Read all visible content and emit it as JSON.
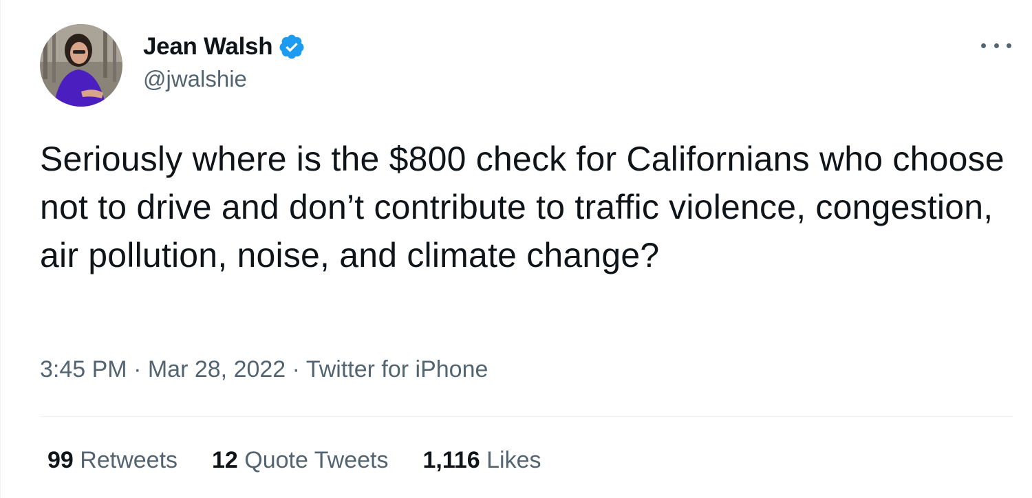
{
  "author": {
    "display_name": "Jean Walsh",
    "handle": "@jwalshie",
    "verified": true
  },
  "icons": {
    "verified": "verified-badge-icon",
    "more": "more-options-icon"
  },
  "tweet": {
    "text": "Seriously where is the $800 check for Californians who choose not to drive and don’t contribute to traffic violence, congestion, air pollution, noise, and climate change?",
    "time": "3:45 PM",
    "separator": "·",
    "date": "Mar 28, 2022",
    "source": "Twitter for iPhone"
  },
  "stats": {
    "retweets": {
      "count": "99",
      "label": "Retweets"
    },
    "quote_tweets": {
      "count": "12",
      "label": "Quote Tweets"
    },
    "likes": {
      "count": "1,116",
      "label": "Likes"
    }
  },
  "colors": {
    "text_primary": "#0f1419",
    "text_secondary": "#536471",
    "verified_blue": "#1d9bf0",
    "divider": "#eff3f4"
  }
}
